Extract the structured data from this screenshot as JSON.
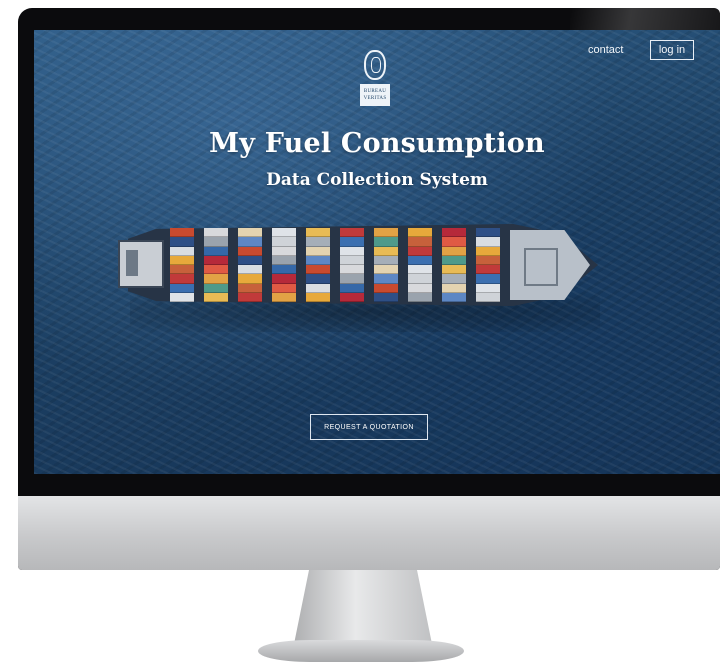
{
  "nav": {
    "contact_label": "contact",
    "login_label": "log in"
  },
  "logo": {
    "line1": "BUREAU",
    "line2": "VERITAS"
  },
  "hero": {
    "title": "My Fuel Consumption",
    "subtitle": "Data Collection System",
    "cta_label": "REQUEST A QUOTATION"
  },
  "colors": {
    "ocean": "#1d4266",
    "text": "#ffffff",
    "monitor_bezel": "#0b0b0d",
    "monitor_chin": "#d4d5d7"
  },
  "container_colors": [
    "#c84a2f",
    "#e7a93b",
    "#3b6fb0",
    "#d8d9dc",
    "#b6293a",
    "#4f9a8a",
    "#e3d3b0",
    "#2e4f86",
    "#c7613b",
    "#dfe3e8",
    "#9aa3ad",
    "#e05a44",
    "#e8bb55",
    "#5d87c4",
    "#d9dde2",
    "#c13a3a",
    "#cfd3d8",
    "#3568a8",
    "#e2a245",
    "#a5aeb8"
  ]
}
